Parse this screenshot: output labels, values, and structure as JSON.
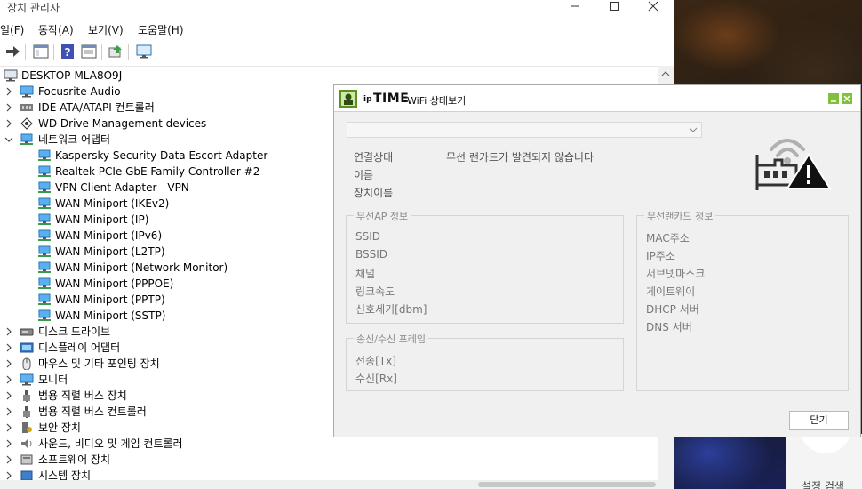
{
  "device_manager": {
    "title": "장치 관리자",
    "menu": [
      "일(F)",
      "동작(A)",
      "보기(V)",
      "도움말(H)"
    ],
    "tree": [
      {
        "label": "DESKTOP-MLA8O9J",
        "icon": "computer-icon",
        "depth": 0,
        "expander": "none"
      },
      {
        "label": "Focusrite Audio",
        "icon": "monitor-icon",
        "depth": 1,
        "expander": "collapsed"
      },
      {
        "label": "IDE ATA/ATAPI 컨트롤러",
        "icon": "ide-controller-icon",
        "depth": 1,
        "expander": "collapsed"
      },
      {
        "label": "WD Drive Management devices",
        "icon": "drive-management-icon",
        "depth": 1,
        "expander": "collapsed"
      },
      {
        "label": "네트워크 어댑터",
        "icon": "network-adapter-icon",
        "depth": 1,
        "expander": "expanded"
      },
      {
        "label": "Kaspersky Security Data Escort Adapter",
        "icon": "network-adapter-icon",
        "depth": 2,
        "expander": "none"
      },
      {
        "label": "Realtek PCIe GbE Family Controller #2",
        "icon": "network-adapter-icon",
        "depth": 2,
        "expander": "none"
      },
      {
        "label": "VPN Client Adapter - VPN",
        "icon": "network-adapter-icon",
        "depth": 2,
        "expander": "none"
      },
      {
        "label": "WAN Miniport (IKEv2)",
        "icon": "network-adapter-icon",
        "depth": 2,
        "expander": "none"
      },
      {
        "label": "WAN Miniport (IP)",
        "icon": "network-adapter-icon",
        "depth": 2,
        "expander": "none"
      },
      {
        "label": "WAN Miniport (IPv6)",
        "icon": "network-adapter-icon",
        "depth": 2,
        "expander": "none"
      },
      {
        "label": "WAN Miniport (L2TP)",
        "icon": "network-adapter-icon",
        "depth": 2,
        "expander": "none"
      },
      {
        "label": "WAN Miniport (Network Monitor)",
        "icon": "network-adapter-icon",
        "depth": 2,
        "expander": "none"
      },
      {
        "label": "WAN Miniport (PPPOE)",
        "icon": "network-adapter-icon",
        "depth": 2,
        "expander": "none"
      },
      {
        "label": "WAN Miniport (PPTP)",
        "icon": "network-adapter-icon",
        "depth": 2,
        "expander": "none"
      },
      {
        "label": "WAN Miniport (SSTP)",
        "icon": "network-adapter-icon",
        "depth": 2,
        "expander": "none"
      },
      {
        "label": "디스크 드라이브",
        "icon": "disk-drive-icon",
        "depth": 1,
        "expander": "collapsed"
      },
      {
        "label": "디스플레이 어댑터",
        "icon": "display-adapter-icon",
        "depth": 1,
        "expander": "collapsed"
      },
      {
        "label": "마우스 및 기타 포인팅 장치",
        "icon": "mouse-icon",
        "depth": 1,
        "expander": "collapsed"
      },
      {
        "label": "모니터",
        "icon": "monitor-icon",
        "depth": 1,
        "expander": "collapsed"
      },
      {
        "label": "범용 직렬 버스 장치",
        "icon": "usb-icon",
        "depth": 1,
        "expander": "collapsed"
      },
      {
        "label": "범용 직렬 버스 컨트롤러",
        "icon": "usb-icon",
        "depth": 1,
        "expander": "collapsed"
      },
      {
        "label": "보안 장치",
        "icon": "security-device-icon",
        "depth": 1,
        "expander": "collapsed"
      },
      {
        "label": "사운드, 비디오 및 게임 컨트롤러",
        "icon": "speaker-icon",
        "depth": 1,
        "expander": "collapsed"
      },
      {
        "label": "소프트웨어 장치",
        "icon": "software-device-icon",
        "depth": 1,
        "expander": "collapsed"
      },
      {
        "label": "시스템 장치",
        "icon": "system-device-icon",
        "depth": 1,
        "expander": "collapsed"
      }
    ]
  },
  "wifi_dialog": {
    "brand_ip": "ip",
    "brand_time": "TIME",
    "app_title": "WiFi 상태보기",
    "adapter_select_value": "",
    "connection_status_label": "연결상태",
    "connection_status_value": "무선 랜카드가 발견되지 않습니다",
    "name_label": "이름",
    "device_name_label": "장치이름",
    "ap_group": {
      "title": "무선AP 정보",
      "fields": [
        "SSID",
        "BSSID",
        "채널",
        "링크속도",
        "신호세기[dbm]"
      ]
    },
    "nic_group": {
      "title": "무선랜카드 정보",
      "fields": [
        "MAC주소",
        "IP주소",
        "서브넷마스크",
        "게이트웨이",
        "DHCP 서버",
        "DNS 서버"
      ]
    },
    "frame_group": {
      "title": "송신/수신 프레임",
      "fields": [
        "전송[Tx]",
        "수신[Rx]"
      ]
    },
    "close_label": "닫기"
  },
  "background": {
    "partial_text": "설정 검색"
  },
  "colors": {
    "accent_green": "#7fc13a",
    "adapter_blue": "#2f8fd8",
    "warning_black": "#111111"
  }
}
